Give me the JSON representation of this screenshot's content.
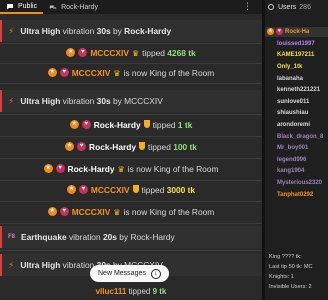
{
  "tabs": {
    "public": "Public",
    "rock": "Rock-Hardy",
    "more": "⋮"
  },
  "users_header": {
    "label": "Users",
    "count": "286"
  },
  "top_user": "Rock-Ha",
  "users": [
    {
      "name": "louissed1997",
      "color": "#b583f0"
    },
    {
      "name": "KAME197211",
      "color": "#f4e04d"
    },
    {
      "name": "Only_1tk",
      "color": "#f4e04d"
    },
    {
      "name": "labanaha",
      "color": "#d8d8d8"
    },
    {
      "name": "kenneth221221",
      "color": "#d8d8d8"
    },
    {
      "name": "sunlove011",
      "color": "#d8d8d8"
    },
    {
      "name": "shiaushiau",
      "color": "#d8d8d8"
    },
    {
      "name": "arondoremi",
      "color": "#d8d8d8"
    },
    {
      "name": "Black_dragon_8",
      "color": "#9a84b8"
    },
    {
      "name": "Mr_boy001",
      "color": "#9a84b8"
    },
    {
      "name": "legend996",
      "color": "#9a84b8"
    },
    {
      "name": "kang1904",
      "color": "#9a84b8"
    },
    {
      "name": "Mysterious2320",
      "color": "#9a84b8"
    },
    {
      "name": "Tanphat0292",
      "color": "#f7941d"
    }
  ],
  "footer": {
    "king": "King ???? tk:",
    "last_tip": "Last tip 50 tk: MC",
    "knights": "Knights: 1",
    "invisible": "Invisible Users: 2"
  },
  "messages": {
    "m1": {
      "prefix": "Ultra High",
      "mid": "vibration",
      "dur": "30s",
      "by": "by",
      "user": "Rock-Hardy"
    },
    "m2": {
      "user": "MCCCXIV",
      "verb": "tipped",
      "amount": "4268 tk"
    },
    "m3": {
      "user": "MCCCXIV",
      "text": "is now King of the Room"
    },
    "m4": {
      "prefix": "Ultra High",
      "mid": "vibration",
      "dur": "30s",
      "by": "by",
      "user": "MCCCXIV"
    },
    "m5": {
      "user": "Rock-Hardy",
      "verb": "tipped",
      "amount": "1 tk"
    },
    "m6": {
      "user": "Rock-Hardy",
      "verb": "tipped",
      "amount": "100 tk"
    },
    "m7": {
      "user": "Rock-Hardy",
      "text": "is now King of the Room"
    },
    "m8": {
      "user": "MCCCXIV",
      "verb": "tipped",
      "amount": "3000 tk"
    },
    "m9": {
      "user": "MCCCXIV",
      "text": "is now King of the Room"
    },
    "m10": {
      "badge": "F8",
      "prefix": "Earthquake",
      "mid": "vibration",
      "dur": "20s",
      "by": "by",
      "user": "Rock-Hardy"
    },
    "m11": {
      "prefix": "Ultra High",
      "mid": "vibration",
      "dur": "30s",
      "by": "by",
      "user": "MCCCXIV"
    },
    "m12": {
      "user": "vlluc111",
      "verb": "tipped",
      "amount": "9 tk"
    }
  },
  "new_messages_label": "New Messages",
  "colors": {
    "accent": "#f28a1c",
    "vibration_bar": "#e23b3b",
    "tip_amount": "#8fe07a"
  }
}
